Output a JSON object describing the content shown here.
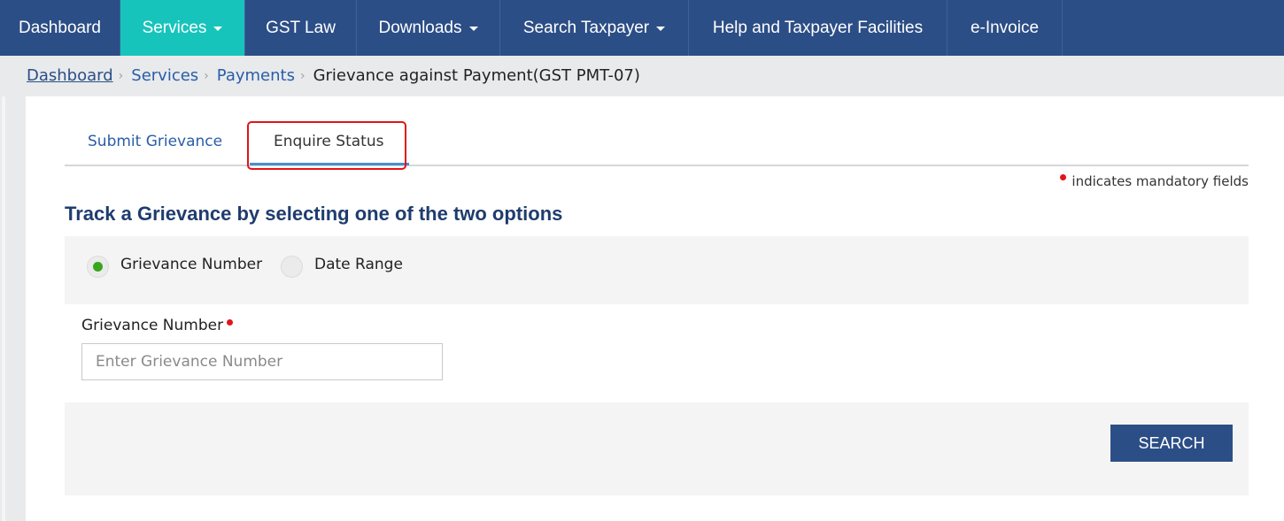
{
  "nav": {
    "items": [
      {
        "label": "Dashboard",
        "dropdown": false
      },
      {
        "label": "Services",
        "dropdown": true,
        "active": true
      },
      {
        "label": "GST Law",
        "dropdown": false
      },
      {
        "label": "Downloads",
        "dropdown": true
      },
      {
        "label": "Search Taxpayer",
        "dropdown": true
      },
      {
        "label": "Help and Taxpayer Facilities",
        "dropdown": false
      },
      {
        "label": "e-Invoice",
        "dropdown": false
      }
    ]
  },
  "breadcrumb": {
    "items": [
      "Dashboard",
      "Services",
      "Payments"
    ],
    "current": "Grievance against Payment(GST PMT-07)"
  },
  "tabs": {
    "submit": "Submit Grievance",
    "enquire": "Enquire Status",
    "active": "Enquire Status"
  },
  "mandatory_note": "indicates mandatory fields",
  "section_title": "Track a Grievance by selecting one of the two options",
  "options": {
    "grievance_number": "Grievance Number",
    "date_range": "Date Range",
    "selected": "Grievance Number"
  },
  "form": {
    "label": "Grievance Number",
    "placeholder": "Enter Grievance Number",
    "value": ""
  },
  "actions": {
    "search": "SEARCH"
  },
  "colors": {
    "navbar": "#2c4e86",
    "nav_active": "#17c4bb",
    "link": "#2a5da8",
    "required": "#e0151b",
    "radio_selected": "#3aa51e",
    "highlight_box": "#e0151b"
  },
  "icons": {
    "dropdown": "caret-down-icon",
    "breadcrumb_separator": "chevron-right-icon",
    "required": "required-dot-icon"
  }
}
